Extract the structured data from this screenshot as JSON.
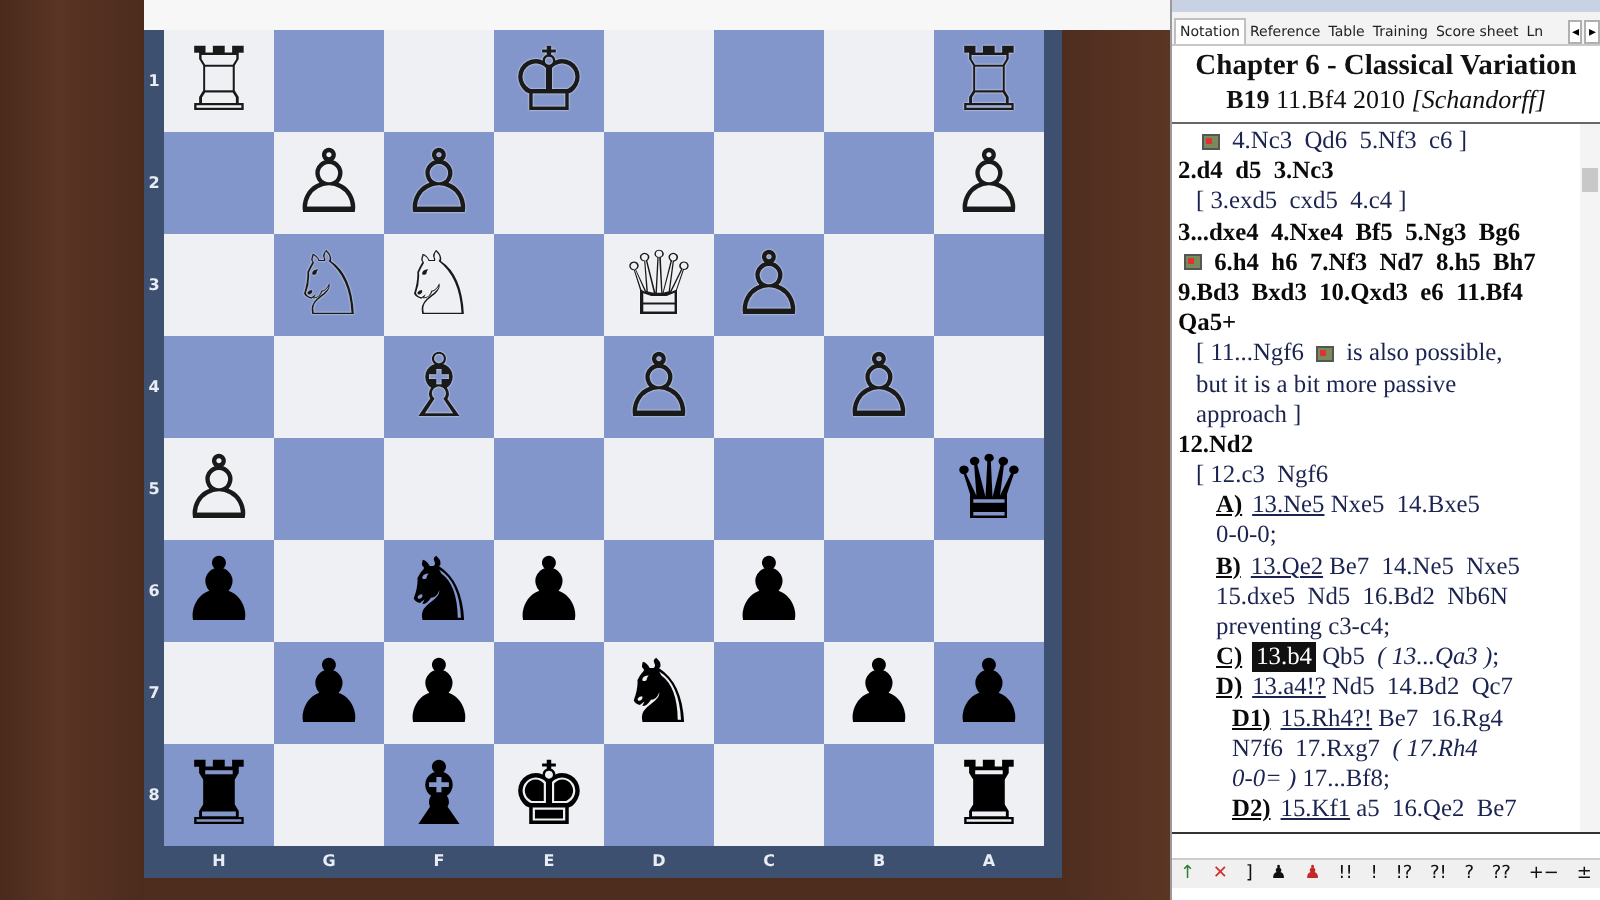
{
  "board": {
    "ranks": [
      {
        "label": "1",
        "squares": [
          {
            "kind": "piece",
            "glyph": "♖",
            "white": true
          },
          {
            "kind": "empty"
          },
          {
            "kind": "empty"
          },
          {
            "kind": "piece",
            "glyph": "♔",
            "white": true
          },
          {
            "kind": "empty"
          },
          {
            "kind": "empty"
          },
          {
            "kind": "empty"
          },
          {
            "kind": "piece",
            "glyph": "♖",
            "white": true
          }
        ]
      },
      {
        "label": "2",
        "squares": [
          {
            "kind": "empty"
          },
          {
            "kind": "piece",
            "glyph": "♙",
            "white": true
          },
          {
            "kind": "piece",
            "glyph": "♙",
            "white": true
          },
          {
            "kind": "empty"
          },
          {
            "kind": "empty"
          },
          {
            "kind": "empty"
          },
          {
            "kind": "empty"
          },
          {
            "kind": "piece",
            "glyph": "♙",
            "white": true
          }
        ]
      },
      {
        "label": "3",
        "squares": [
          {
            "kind": "empty"
          },
          {
            "kind": "piece",
            "glyph": "♘",
            "white": true
          },
          {
            "kind": "piece",
            "glyph": "♘",
            "white": true
          },
          {
            "kind": "empty"
          },
          {
            "kind": "piece",
            "glyph": "♕",
            "white": true
          },
          {
            "kind": "piece",
            "glyph": "♙",
            "white": true
          },
          {
            "kind": "empty"
          },
          {
            "kind": "empty"
          }
        ]
      },
      {
        "label": "4",
        "squares": [
          {
            "kind": "empty"
          },
          {
            "kind": "empty"
          },
          {
            "kind": "piece",
            "glyph": "♗",
            "white": true
          },
          {
            "kind": "empty"
          },
          {
            "kind": "piece",
            "glyph": "♙",
            "white": true
          },
          {
            "kind": "empty"
          },
          {
            "kind": "piece",
            "glyph": "♙",
            "white": true
          },
          {
            "kind": "empty"
          }
        ]
      },
      {
        "label": "5",
        "squares": [
          {
            "kind": "piece",
            "glyph": "♙",
            "white": true
          },
          {
            "kind": "empty"
          },
          {
            "kind": "empty"
          },
          {
            "kind": "empty"
          },
          {
            "kind": "empty"
          },
          {
            "kind": "empty"
          },
          {
            "kind": "empty"
          },
          {
            "kind": "piece",
            "glyph": "♛",
            "white": false
          }
        ]
      },
      {
        "label": "6",
        "squares": [
          {
            "kind": "piece",
            "glyph": "♟",
            "white": false
          },
          {
            "kind": "empty"
          },
          {
            "kind": "piece",
            "glyph": "♞",
            "white": false
          },
          {
            "kind": "piece",
            "glyph": "♟",
            "white": false
          },
          {
            "kind": "empty"
          },
          {
            "kind": "piece",
            "glyph": "♟",
            "white": false
          },
          {
            "kind": "empty"
          },
          {
            "kind": "empty"
          }
        ]
      },
      {
        "label": "7",
        "squares": [
          {
            "kind": "empty"
          },
          {
            "kind": "piece",
            "glyph": "♟",
            "white": false
          },
          {
            "kind": "piece",
            "glyph": "♟",
            "white": false
          },
          {
            "kind": "empty"
          },
          {
            "kind": "piece",
            "glyph": "♞",
            "white": false
          },
          {
            "kind": "empty"
          },
          {
            "kind": "piece",
            "glyph": "♟",
            "white": false
          },
          {
            "kind": "piece",
            "glyph": "♟",
            "white": false
          }
        ]
      },
      {
        "label": "8",
        "squares": [
          {
            "kind": "piece",
            "glyph": "♜",
            "white": false
          },
          {
            "kind": "empty"
          },
          {
            "kind": "piece",
            "glyph": "♝",
            "white": false
          },
          {
            "kind": "piece",
            "glyph": "♚",
            "white": false
          },
          {
            "kind": "empty"
          },
          {
            "kind": "empty"
          },
          {
            "kind": "empty"
          },
          {
            "kind": "piece",
            "glyph": "♜",
            "white": false
          }
        ]
      }
    ],
    "files": [
      "H",
      "G",
      "F",
      "E",
      "D",
      "C",
      "B",
      "A"
    ]
  },
  "panel": {
    "tabs": [
      {
        "label": "Notation",
        "selected": true
      },
      {
        "label": "Reference",
        "selected": false
      },
      {
        "label": "Table",
        "selected": false
      },
      {
        "label": "Training",
        "selected": false
      },
      {
        "label": "Score sheet",
        "selected": false
      },
      {
        "label": "Ln",
        "selected": false
      }
    ],
    "tab_scroll": [
      "◂",
      "▸"
    ],
    "heading": "Chapter 6 - Classical Variation",
    "subheading": "**B19** 11.Bf4 2010 *[Schandorff]*",
    "notation": [
      {
        "kind": "variation",
        "segments": [
          {
            "kind": "diagram"
          },
          {
            "kind": "text",
            "text": " 4.Nc3  Qd6  5.Nf3  c6 ]"
          }
        ]
      },
      {
        "kind": "main",
        "segments": [
          {
            "kind": "text",
            "text": "2.d4  d5  3.Nc3"
          }
        ]
      },
      {
        "kind": "variation",
        "segments": [
          {
            "kind": "text",
            "text": "[ 3.exd5  cxd5  4.c4 ]"
          }
        ]
      },
      {
        "kind": "main",
        "segments": [
          {
            "kind": "text",
            "text": "3...dxe4  4.Nxe4  Bf5  5.Ng3  Bg6"
          }
        ]
      },
      {
        "kind": "main",
        "segments": [
          {
            "kind": "diagram"
          },
          {
            "kind": "text",
            "text": " 6.h4  h6  7.Nf3  Nd7  8.h5  Bh7"
          }
        ]
      },
      {
        "kind": "main",
        "segments": [
          {
            "kind": "text",
            "text": "9.Bd3  Bxd3  10.Qxd3  e6  11.Bf4"
          }
        ]
      },
      {
        "kind": "main",
        "segments": [
          {
            "kind": "text",
            "text": "Qa5+"
          }
        ]
      },
      {
        "kind": "variation",
        "segments": [
          {
            "kind": "text",
            "text": "[ 11...Ngf6 "
          },
          {
            "kind": "diagram"
          },
          {
            "kind": "text",
            "text": " is also possible,"
          }
        ]
      },
      {
        "kind": "variation",
        "segments": [
          {
            "kind": "text",
            "text": "but it is a bit more passive"
          }
        ]
      },
      {
        "kind": "variation",
        "segments": [
          {
            "kind": "text",
            "text": "approach ]"
          }
        ]
      },
      {
        "kind": "main",
        "segments": [
          {
            "kind": "text",
            "text": "12.Nd2"
          }
        ]
      },
      {
        "kind": "variation",
        "segments": [
          {
            "kind": "text",
            "text": "[ 12.c3  Ngf6"
          }
        ]
      },
      {
        "kind": "branch",
        "segments": [
          {
            "kind": "label",
            "text": "A)"
          },
          {
            "kind": "link",
            "text": "13.Ne5"
          },
          {
            "kind": "text",
            "text": " Nxe5  14.Bxe5"
          }
        ]
      },
      {
        "kind": "branch",
        "segments": [
          {
            "kind": "text",
            "text": "0-0-0;"
          }
        ]
      },
      {
        "kind": "branch",
        "segments": [
          {
            "kind": "label",
            "text": "B)"
          },
          {
            "kind": "link",
            "text": "13.Qe2"
          },
          {
            "kind": "text",
            "text": " Be7  14.Ne5  Nxe5"
          }
        ]
      },
      {
        "kind": "branch",
        "segments": [
          {
            "kind": "text",
            "text": "15.dxe5  Nd5  16.Bd2  Nb6N"
          }
        ]
      },
      {
        "kind": "branch",
        "segments": [
          {
            "kind": "text",
            "text": "preventing c3-c4;"
          }
        ]
      },
      {
        "kind": "branch",
        "segments": [
          {
            "kind": "label",
            "text": "C)"
          },
          {
            "kind": "current",
            "text": "13.b4"
          },
          {
            "kind": "text",
            "text": " Qb5 "
          },
          {
            "kind": "italic",
            "text": " ( 13...Qa3 )"
          },
          {
            "kind": "text",
            "text": ";"
          }
        ]
      },
      {
        "kind": "branch",
        "segments": [
          {
            "kind": "label",
            "text": "D)"
          },
          {
            "kind": "link",
            "text": "13.a4!?"
          },
          {
            "kind": "text",
            "text": " Nd5  14.Bd2  Qc7"
          }
        ]
      },
      {
        "kind": "subbranch",
        "segments": [
          {
            "kind": "label",
            "text": "D1)"
          },
          {
            "kind": "link",
            "text": "15.Rh4?!"
          },
          {
            "kind": "text",
            "text": " Be7  16.Rg4"
          }
        ]
      },
      {
        "kind": "subbranch",
        "segments": [
          {
            "kind": "text",
            "text": "N7f6  17.Rxg7 "
          },
          {
            "kind": "italic",
            "text": " ( 17.Rh4"
          }
        ]
      },
      {
        "kind": "subbranch",
        "segments": [
          {
            "kind": "italic",
            "text": "0-0= )"
          },
          {
            "kind": "text",
            "text": " 17...Bf8;"
          }
        ]
      },
      {
        "kind": "subbranch",
        "segments": [
          {
            "kind": "label",
            "text": "D2)"
          },
          {
            "kind": "link",
            "text": "15.Kf1"
          },
          {
            "kind": "text",
            "text": " a5  16.Qe2  Be7"
          }
        ]
      }
    ],
    "toolbar": [
      {
        "text": "↑",
        "color": "#2e7d32"
      },
      {
        "text": "✕",
        "color": "#d32f2f"
      },
      {
        "text": "]",
        "color": "#111111"
      },
      {
        "text": "♟",
        "color": "#111111"
      },
      {
        "text": "♟",
        "color": "#c62828"
      },
      {
        "text": "!!",
        "color": "#111111"
      },
      {
        "text": "!",
        "color": "#111111"
      },
      {
        "text": "!?",
        "color": "#111111"
      },
      {
        "text": "?!",
        "color": "#111111"
      },
      {
        "text": "?",
        "color": "#111111"
      },
      {
        "text": "??",
        "color": "#111111"
      },
      {
        "text": "+−",
        "color": "#111111"
      },
      {
        "text": "±",
        "color": "#111111"
      }
    ]
  }
}
